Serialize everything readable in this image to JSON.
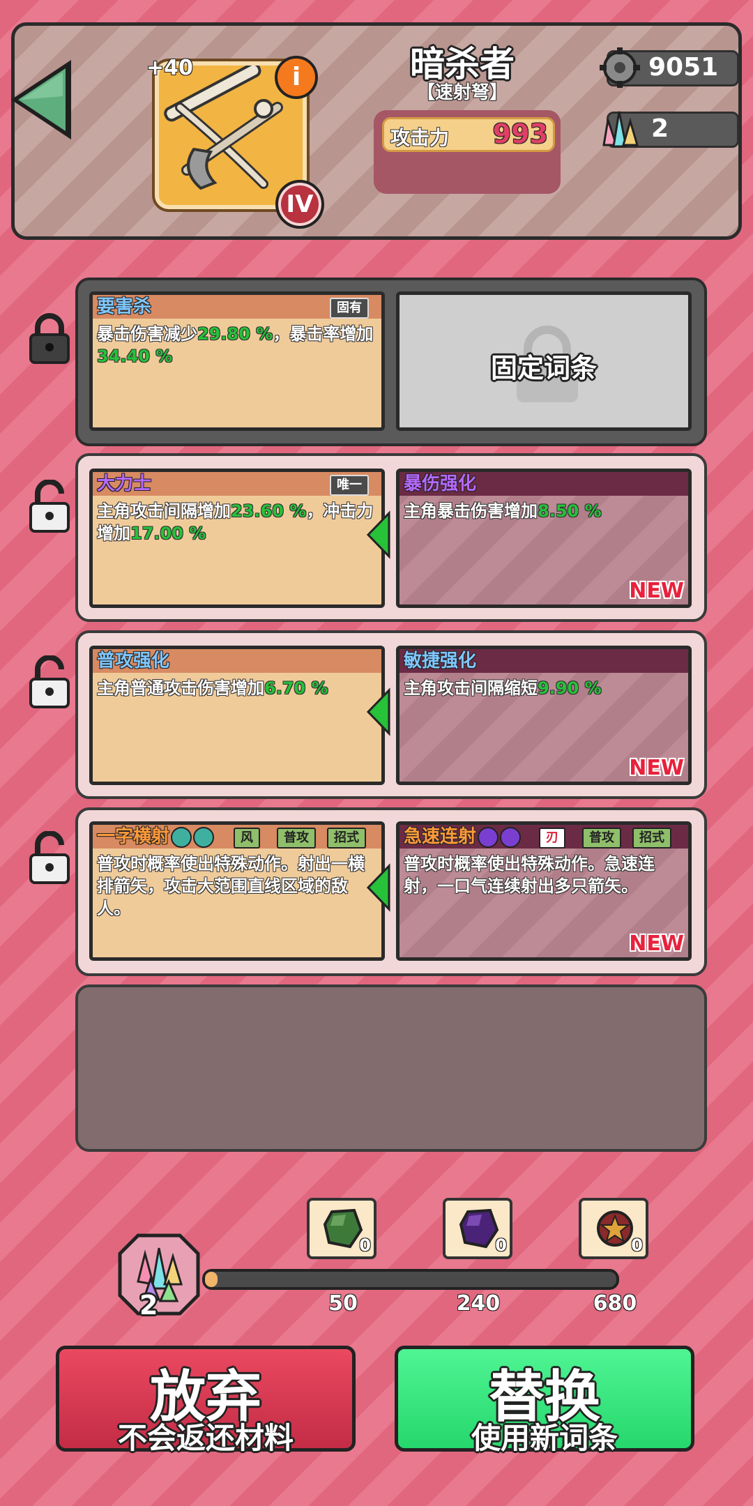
{
  "header": {
    "class_name": "暗杀者",
    "weapon_type": "【速射弩】",
    "weapon_level": "+40",
    "info_glyph": "i",
    "rank": "IV",
    "attack_label": "攻击力",
    "attack_value": "993",
    "gear_count": "9051",
    "gem_count": "2"
  },
  "rows": [
    {
      "old": {
        "title": "要害杀",
        "tag": "固有",
        "desc_parts": [
          "暴击伤害减少",
          "29.80 %",
          "，暴击率增加",
          "34.40 %"
        ]
      },
      "fixed_label": "固定词条"
    },
    {
      "old": {
        "title": "大力士",
        "tag": "唯一",
        "desc_parts": [
          "主角攻击间隔增加",
          "23.60 %",
          "，冲击力增加",
          "17.00 %"
        ]
      },
      "new": {
        "title": "暴伤强化",
        "desc_parts": [
          "主角暴击伤害增加",
          "8.50 %"
        ]
      }
    },
    {
      "old": {
        "title": "普攻强化",
        "desc_parts": [
          "主角普通攻击伤害增加",
          "6.70 %"
        ]
      },
      "new": {
        "title": "敏捷强化",
        "desc_parts": [
          "主角攻击间隔缩短",
          "9.90 %"
        ]
      }
    },
    {
      "old": {
        "title": "一字横射",
        "tags": [
          "风",
          "普攻",
          "招式"
        ],
        "desc": "普攻时概率使出特殊动作。射出一横排箭矢，攻击大范围直线区域的敌人。"
      },
      "new": {
        "title": "急速连射",
        "tags": [
          "刃",
          "普攻",
          "招式"
        ],
        "desc": "普攻时概率使出特殊动作。急速连射，一口气连续射出多只箭矢。"
      }
    }
  ],
  "new_label": "NEW",
  "materials": {
    "owned": "2",
    "stones": [
      {
        "name": "green-stone",
        "count": "0",
        "threshold": "50"
      },
      {
        "name": "purple-stone",
        "count": "0",
        "threshold": "240"
      },
      {
        "name": "red-star-stone",
        "count": "0",
        "threshold": "680"
      }
    ],
    "progress_fraction": 0.0
  },
  "buttons": {
    "abandon_main": "放弃",
    "abandon_sub": "不会返还材料",
    "replace_main": "替换",
    "replace_sub": "使用新词条"
  },
  "colors": {
    "highlight_green": "#27c13a",
    "new_red": "#e8213c",
    "abandon": "#d63750",
    "replace": "#3be880"
  }
}
